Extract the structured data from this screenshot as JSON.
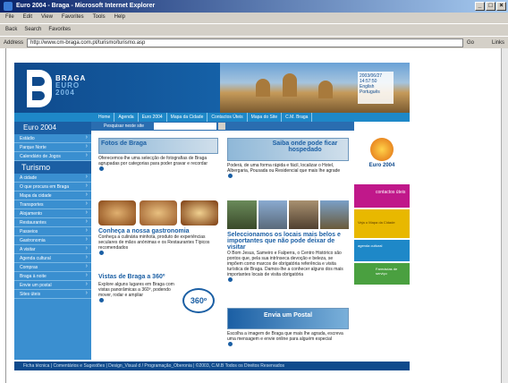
{
  "window": {
    "title": "Euro 2004 - Braga - Microsoft Internet Explorer"
  },
  "menu": [
    "File",
    "Edit",
    "View",
    "Favorites",
    "Tools",
    "Help"
  ],
  "toolbar": [
    "Back",
    "Search",
    "Favorites"
  ],
  "address": {
    "label": "Address",
    "url": "http://www.cm-braga.com.pt/turismo/turismo.asp",
    "go": "Go",
    "links": "Links"
  },
  "header": {
    "logo_line1": "BRAGA",
    "logo_line2": "EURO",
    "logo_line3": "2004",
    "date_text": "2003/06/27",
    "time_text": "14:57:50",
    "lang1": "English",
    "lang2": "Português"
  },
  "nav": [
    "Home",
    "Agenda",
    "Euro 2004",
    "Mapa da Cidade",
    "Contactos Úteis",
    "Mapa do Site",
    "C.M. Braga"
  ],
  "search": {
    "label": "Pesquisar neste site"
  },
  "sidebar": {
    "section1": "Euro 2004",
    "items1": [
      "Estádio",
      "Parque Norte",
      "Calendário de Jogos"
    ],
    "section2": "Turismo",
    "items2": [
      "A cidade",
      "O que procura em Braga",
      "Mapa da cidade",
      "Transportes",
      "Alojamento",
      "Restaurantes",
      "Passeios",
      "Gastronomia",
      "A visitar",
      "Agenda cultural",
      "Compras",
      "Braga à noite",
      "Envie um postal",
      "Sites úteis"
    ]
  },
  "blocks": {
    "fotos": {
      "title": "Fotos de Braga",
      "text": "Oferecemos-lhe uma selecção de fotografias de Braga agrupadas por categorias para poder gravar e recordar"
    },
    "hospedado": {
      "title": "Saiba onde pode ficar hospedado",
      "text": "Poderá, de uma forma rápida e fácil, localizar o Hotel, Albergaria, Pousada ou Residencial que mais lhe agrade"
    },
    "gastronomia": {
      "title": "Conheça a nossa gastronomia",
      "text": "Conheça a culinária minhota, produto de experiências seculares de mãos anónimas e os Restaurantes Típicos recomendados"
    },
    "locais": {
      "title": "Seleccionamos os locais mais belos e importantes que não pode deixar de visitar",
      "text": "O Bom Jesus, Sameiro e Falperra, o Centro Histórico são pontos que, pela sua intrínseca devoção e beleza, se impõem como marcos de obrigatória referência e visita turística de Braga. Damos-lhe a conhecer alguns dos mais importantes locais de visita obrigatória"
    },
    "vistas": {
      "title": "Vistas de Braga a 360º",
      "text": "Explore alguns lugares em Braga com vistas panorâmicas a 360º, podendo mover, rodar e ampliar",
      "badge": "360º"
    },
    "postal": {
      "title": "Envia um Postal",
      "text": "Escolha a imagem de Braga que mais lhe agrada, escreva uma mensagem e envie online para alguém especial"
    }
  },
  "right": {
    "euro": "Euro 2004",
    "contactos": "contactos úteis",
    "mapa": "Veja o Mapa da Cidade",
    "agenda": "agenda cultural",
    "farmacias": "Farmácias de serviço"
  },
  "footer": {
    "text": "Ficha técnica  |  Comentários e Sugestões  |  Design_Visual d / Programação_Oberonia  |  ©2003, C.M.B Todos os Direitos Reservados"
  }
}
